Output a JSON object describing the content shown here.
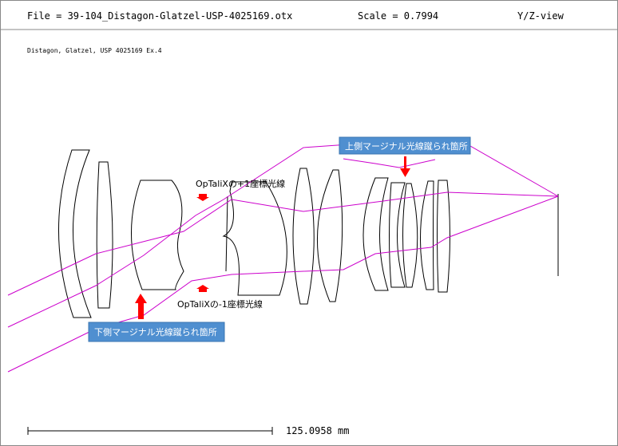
{
  "header": {
    "file": "File = 39-104_Distagon-Glatzel-USP-4025169.otx",
    "scale": "Scale = 0.7994",
    "view": "Y/Z-view"
  },
  "subtitle": "Distagon, Glatzel, USP 4025169 Ex.4",
  "annotations": {
    "upper_marginal": "上側マージナル光線蹴られ箇所",
    "lower_marginal": "下側マージナル光線蹴られ箇所",
    "plus_chief": "OpTaliXの+1座標光線",
    "minus_chief": "OpTaliXの-1座標光線"
  },
  "scale_bar_label": "125.0958 mm",
  "colors": {
    "ray": "#cc00cc",
    "arrow": "#ff0000",
    "callout": "#4f8fd0"
  }
}
